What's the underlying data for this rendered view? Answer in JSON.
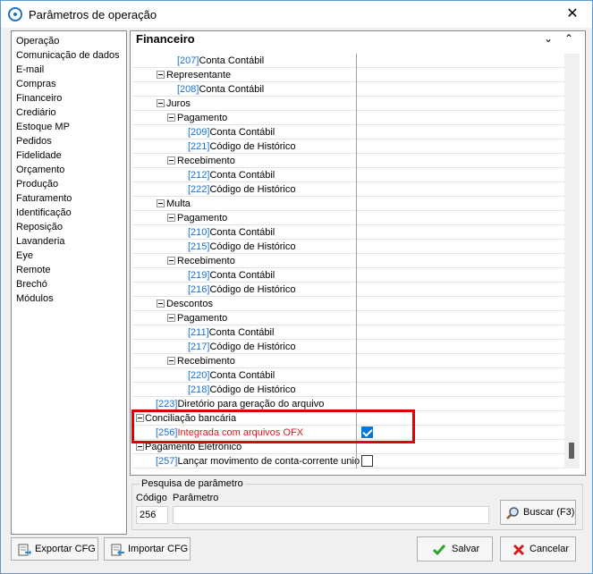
{
  "window": {
    "title": "Parâmetros de operação"
  },
  "nav": {
    "items": [
      "Operação",
      "Comunicação de dados",
      "E-mail",
      "Compras",
      "Financeiro",
      "Crediário",
      "Estoque MP",
      "Pedidos",
      "Fidelidade",
      "Orçamento",
      "Produção",
      "Faturamento",
      "Identificação",
      "Reposição",
      "Lavanderia",
      "Eye",
      "Remote",
      "Brechó",
      "Módulos"
    ],
    "selected": "Financeiro"
  },
  "section": {
    "title": "Financeiro"
  },
  "tree": {
    "rows": [
      {
        "code": "[207]",
        "label": "Conta Contábil"
      },
      {
        "label": "Representante"
      },
      {
        "code": "[208]",
        "label": "Conta Contábil"
      },
      {
        "label": "Juros"
      },
      {
        "label": "Pagamento"
      },
      {
        "code": "[209]",
        "label": "Conta Contábil"
      },
      {
        "code": "[221]",
        "label": "Código de Histórico"
      },
      {
        "label": "Recebimento"
      },
      {
        "code": "[212]",
        "label": "Conta Contábil"
      },
      {
        "code": "[222]",
        "label": "Código de Histórico"
      },
      {
        "label": "Multa"
      },
      {
        "label": "Pagamento"
      },
      {
        "code": "[210]",
        "label": "Conta Contábil"
      },
      {
        "code": "[215]",
        "label": "Código de Histórico"
      },
      {
        "label": "Recebimento"
      },
      {
        "code": "[219]",
        "label": "Conta Contábil"
      },
      {
        "code": "[216]",
        "label": "Código de Histórico"
      },
      {
        "label": "Descontos"
      },
      {
        "label": "Pagamento"
      },
      {
        "code": "[211]",
        "label": "Conta Contábil"
      },
      {
        "code": "[217]",
        "label": "Código de Histórico"
      },
      {
        "label": "Recebimento"
      },
      {
        "code": "[220]",
        "label": "Conta Contábil"
      },
      {
        "code": "[218]",
        "label": "Código de Histórico"
      },
      {
        "code": "[223]",
        "label": "Diretório para geração do arquivo"
      },
      {
        "label": "Conciliação bancária"
      },
      {
        "code": "[256]",
        "label": "Integrada com arquivos OFX",
        "checked": true
      },
      {
        "label": "Pagamento Eletrônico"
      },
      {
        "code": "[257]",
        "label": "Lançar movimento de conta-corrente unio",
        "checked": false
      }
    ]
  },
  "search": {
    "legend": "Pesquisa de parâmetro",
    "code_label": "Código",
    "param_label": "Parâmetro",
    "code_value": "256",
    "param_value": "",
    "button": "Buscar (F3)"
  },
  "footer": {
    "export_label": "Exportar CFG",
    "import_label": "Importar CFG",
    "save_label": "Salvar",
    "cancel_label": "Cancelar"
  },
  "colors": {
    "code_blue": "#1a73c9",
    "highlight_red": "#e00000",
    "checkbox_blue": "#0078d7"
  }
}
